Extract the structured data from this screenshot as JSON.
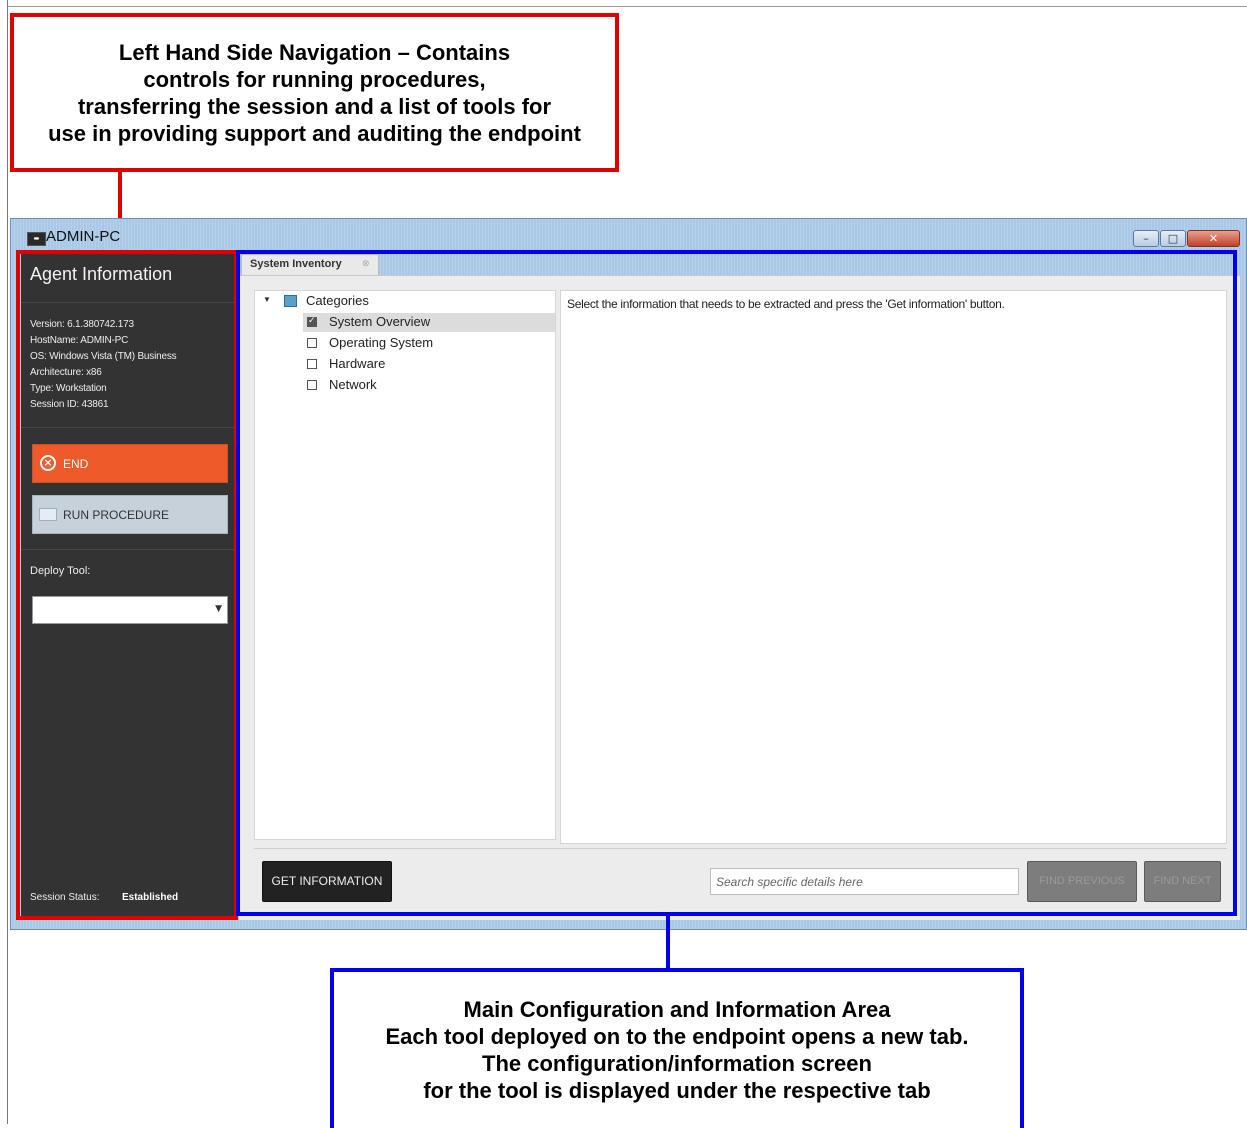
{
  "callouts": {
    "left_nav": "Left Hand Side Navigation – Contains\ncontrols for running procedures,\ntransferring the session  and a list of tools for\nuse in providing support and auditing the endpoint",
    "main_area": "Main Configuration and Information Area\nEach tool deployed on to the endpoint opens a new tab.\nThe configuration/information screen\nfor the tool is displayed under the respective tab"
  },
  "window": {
    "title": "ADMIN-PC",
    "icon": "app-icon",
    "controls": [
      "minimize-icon",
      "maximize-icon",
      "close-icon"
    ]
  },
  "sidebar": {
    "title": "Agent Information",
    "info": [
      "Version: 6.1.380742.173",
      "HostName: ADMIN-PC",
      "OS: Windows Vista (TM) Business",
      "Architecture: x86",
      "Type: Workstation",
      "Session ID: 43861"
    ],
    "end_label": "END",
    "run_label": "RUN PROCEDURE",
    "deploy_label": "Deploy Tool:",
    "deploy_value": "",
    "status_label": "Session Status:",
    "status_value": "Established",
    "colors": {
      "background": "#333333",
      "end": "#ef5a2a",
      "run": "#c7d1da"
    }
  },
  "main": {
    "tab_label": "System Inventory",
    "tree": {
      "root": "Categories",
      "items": [
        {
          "label": "System Overview",
          "checked": true,
          "selected": true
        },
        {
          "label": "Operating System",
          "checked": false,
          "selected": false
        },
        {
          "label": "Hardware",
          "checked": false,
          "selected": false
        },
        {
          "label": "Network",
          "checked": false,
          "selected": false
        }
      ]
    },
    "message": "Select the information that needs to be extracted and press the 'Get information' button.",
    "get_info_label": "GET INFORMATION",
    "search_placeholder": "Search specific details here",
    "find_prev_label": "FIND PREVIOUS",
    "find_next_label": "FIND NEXT"
  }
}
